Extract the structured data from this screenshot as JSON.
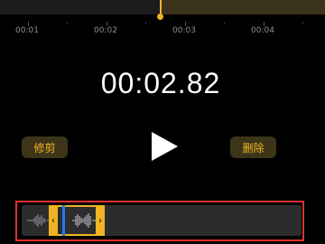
{
  "timeline": {
    "ticks": [
      "00:01",
      "00:02",
      "00:03",
      "00:04"
    ]
  },
  "timer": {
    "elapsed": "00:02.82"
  },
  "controls": {
    "trim_label": "修剪",
    "delete_label": "删除",
    "play_icon": "play-icon"
  },
  "trim_bar": {
    "handle_icons": [
      "chevron-left-icon",
      "chevron-right-icon"
    ]
  },
  "colors": {
    "accent": "#f0b323",
    "button_bg": "#3d3519",
    "mini_playhead": "#1e7bf5",
    "highlight": "#e03131",
    "track_bg": "#2c2c2e"
  }
}
